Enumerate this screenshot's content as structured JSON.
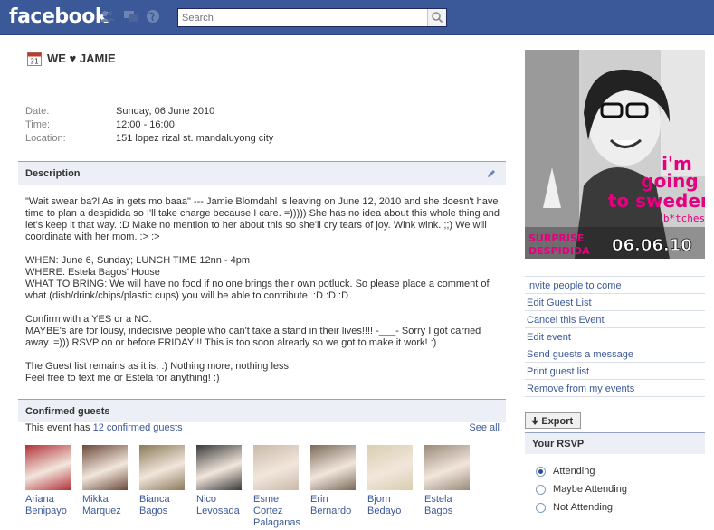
{
  "header": {
    "logo": "facebook",
    "search_placeholder": "Search"
  },
  "event": {
    "title": "WE ♥ JAMIE",
    "calendar_day": "31",
    "info": [
      {
        "label": "Date:",
        "value": "Sunday, 06 June 2010"
      },
      {
        "label": "Time:",
        "value": "12:00 - 16:00"
      },
      {
        "label": "Location:",
        "value": "151 lopez rizal st. mandaluyong city"
      }
    ]
  },
  "description": {
    "heading": "Description",
    "paragraphs": [
      "\"Wait swear ba?! As in gets mo baaa\" --- Jamie Blomdahl is leaving on June 12, 2010 and she doesn't have time to plan a despidida so I'll take charge because I care. =))))) She has no idea about this whole thing and let's keep it that way. :D Make no mention to her about this so she'll cry tears of joy. Wink wink. ;;) We will coordinate with her mom. :> :>",
      "WHEN: June 6, Sunday; LUNCH TIME 12nn - 4pm\nWHERE: Estela Bagos' House\nWHAT TO BRING: We will have no food if no one brings their own potluck. So please place a comment of what (dish/drink/chips/plastic cups) you will be able to contribute. :D :D :D",
      "Confirm with a YES or a NO.\nMAYBE's are for lousy, indecisive people who can't take a stand in their lives!!!! -___- Sorry I got carried away. =))) RSVP on or before FRIDAY!!! This is too soon already so we got to make it work! :)",
      "The Guest list remains as it is. :) Nothing more, nothing less.\nFeel free to text me or Estela for anything! :)"
    ]
  },
  "guests": {
    "heading": "Confirmed guests",
    "summary_prefix": "This event has ",
    "summary_link": "12 confirmed guests",
    "see_all": "See all",
    "list": [
      {
        "name": "Ariana Benipayo",
        "color": "#b2323a"
      },
      {
        "name": "Mikka Marquez",
        "color": "#6a4a3a"
      },
      {
        "name": "Bianca Bagos",
        "color": "#8a7a5a"
      },
      {
        "name": "Nico Levosada",
        "color": "#3a3a3a"
      },
      {
        "name": "Esme Cortez Palaganas",
        "color": "#c9b9a9"
      },
      {
        "name": "Erin Bernardo",
        "color": "#7a6a5a"
      },
      {
        "name": "Bjorn Bedayo",
        "color": "#d8cfb0"
      },
      {
        "name": "Estela Bagos",
        "color": "#9a8a7a"
      }
    ]
  },
  "poster": {
    "line1": "i'm",
    "line2": "going",
    "line3": "to sweden",
    "line4": "b*tches",
    "line5": "SURPRISE",
    "line6": "DESPIDIDA",
    "date": "06.06.10"
  },
  "actions": [
    "Invite people to come",
    "Edit Guest List",
    "Cancel this Event",
    "Edit event",
    "Send guests a message",
    "Print guest list",
    "Remove from my events"
  ],
  "export_label": "Export",
  "rsvp": {
    "heading": "Your RSVP",
    "options": [
      {
        "label": "Attending",
        "selected": true
      },
      {
        "label": "Maybe Attending",
        "selected": false
      },
      {
        "label": "Not Attending",
        "selected": false
      }
    ]
  }
}
